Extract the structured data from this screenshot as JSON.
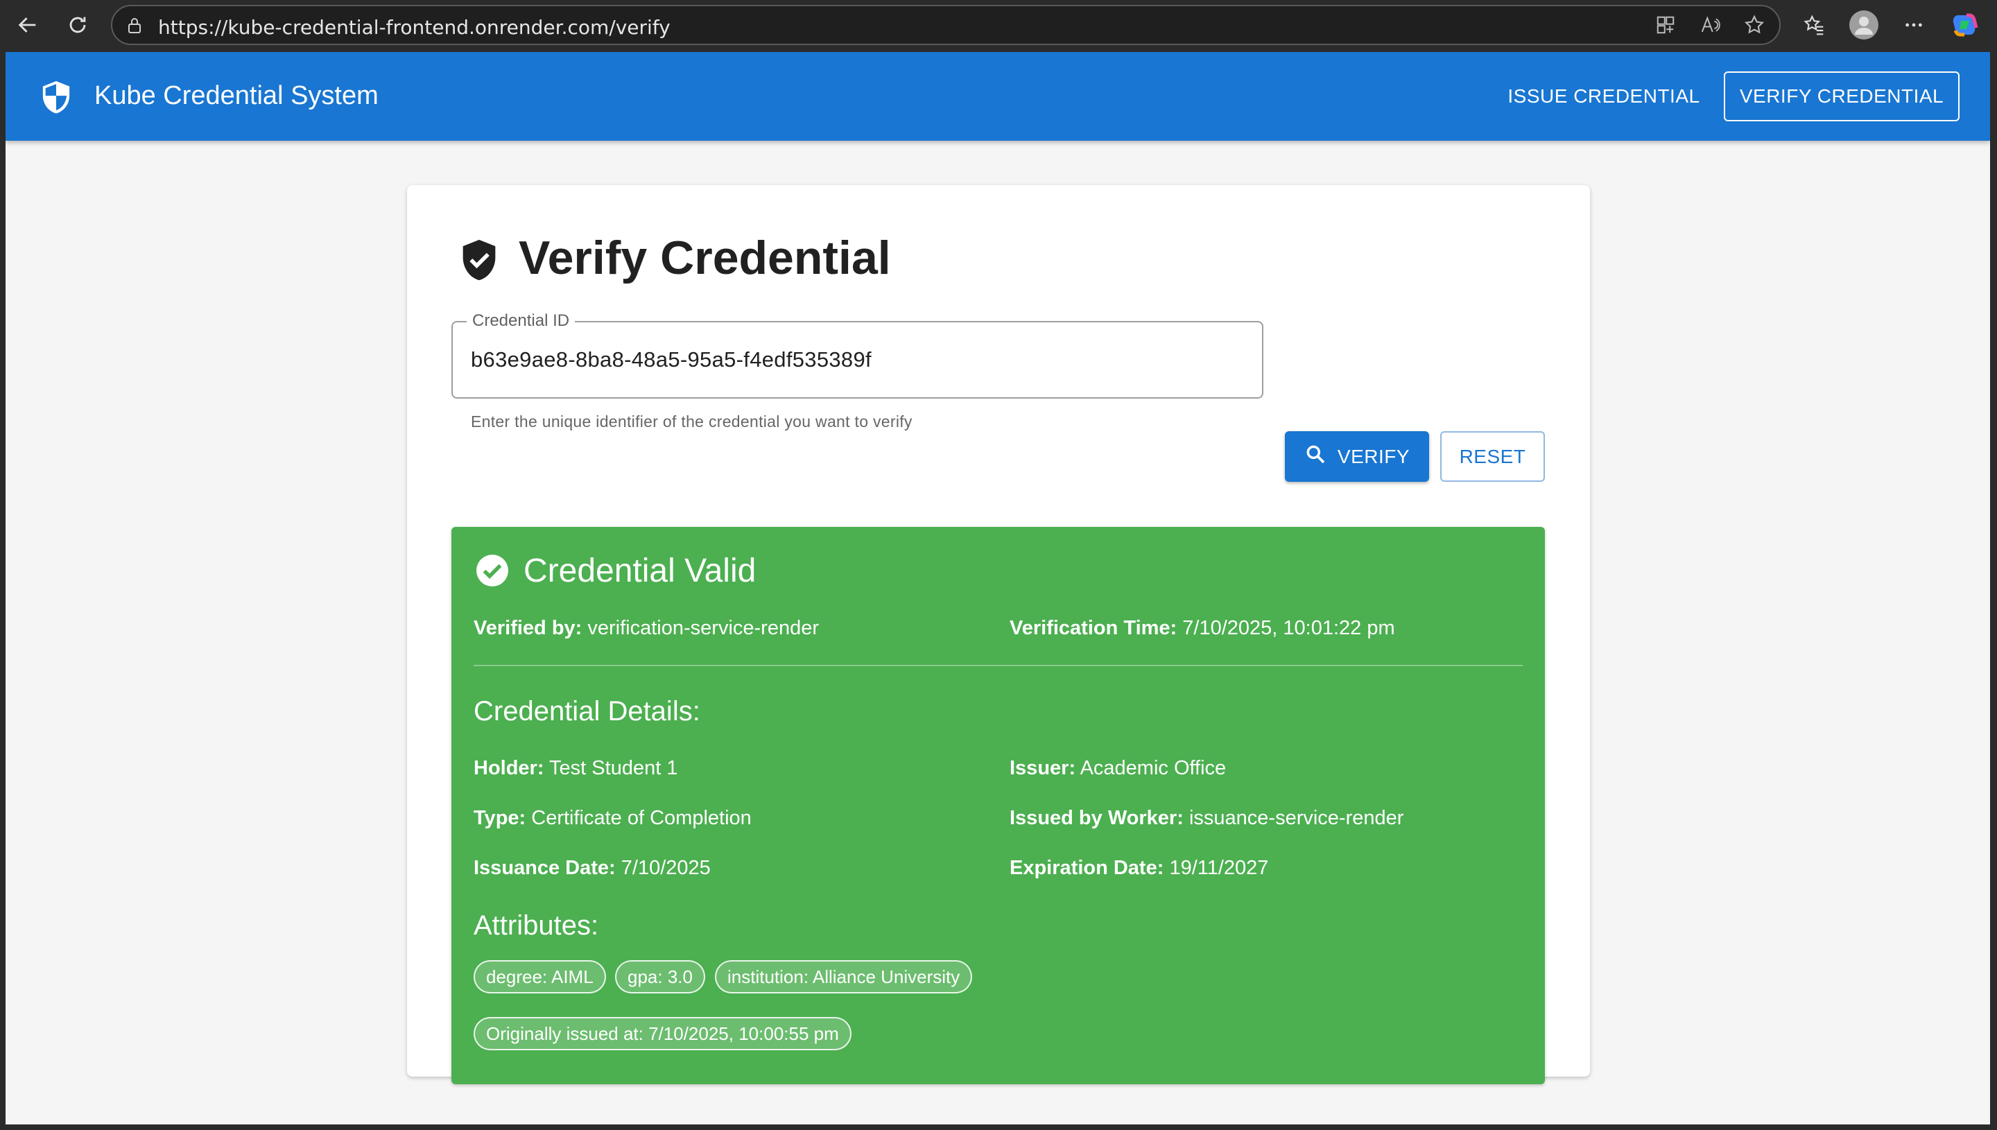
{
  "browser": {
    "url": "https://kube-credential-frontend.onrender.com/verify"
  },
  "app": {
    "title": "Kube Credential System",
    "nav": {
      "issue": "ISSUE CREDENTIAL",
      "verify": "VERIFY CREDENTIAL"
    }
  },
  "page": {
    "title": "Verify Credential",
    "field": {
      "label": "Credential ID",
      "value": "b63e9ae8-8ba8-48a5-95a5-f4edf535389f",
      "helper": "Enter the unique identifier of the credential you want to verify"
    },
    "buttons": {
      "verify": "VERIFY",
      "reset": "RESET"
    }
  },
  "result": {
    "title": "Credential Valid",
    "verified_by_label": "Verified by:",
    "verified_by_value": "verification-service-render",
    "verification_time_label": "Verification Time:",
    "verification_time_value": "7/10/2025, 10:01:22 pm",
    "details_title": "Credential Details:",
    "holder_label": "Holder:",
    "holder_value": "Test Student 1",
    "issuer_label": "Issuer:",
    "issuer_value": "Academic Office",
    "type_label": "Type:",
    "type_value": "Certificate of Completion",
    "worker_label": "Issued by Worker:",
    "worker_value": "issuance-service-render",
    "issuance_label": "Issuance Date:",
    "issuance_value": "7/10/2025",
    "expiration_label": "Expiration Date:",
    "expiration_value": "19/11/2027",
    "attributes_title": "Attributes:",
    "chips": [
      "degree: AIML",
      "gpa: 3.0",
      "institution: Alliance University"
    ],
    "original_issue": "Originally issued at: 7/10/2025, 10:00:55 pm"
  },
  "colors": {
    "primary": "#1976d2",
    "success": "#4caf50"
  }
}
